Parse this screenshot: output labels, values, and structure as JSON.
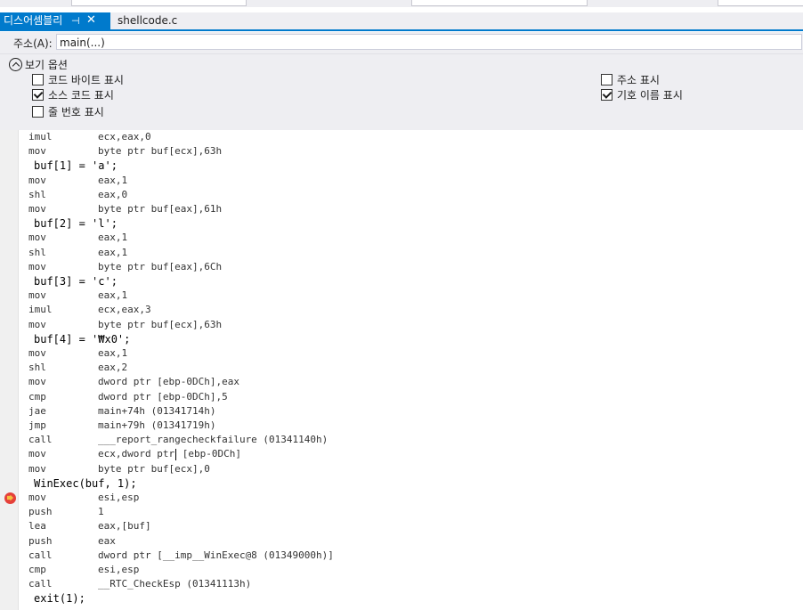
{
  "tabs": [
    {
      "label": "디스어셈블리",
      "pin": "⊣",
      "close": "✕",
      "active": true
    },
    {
      "label": "shellcode.c",
      "active": false
    }
  ],
  "address": {
    "label": "주소(A):",
    "value": "main(...)"
  },
  "options": {
    "toggle_label": "보기 옵션",
    "checkboxes": [
      {
        "label": "코드 바이트 표시",
        "checked": false
      },
      {
        "label": "소스 코드 표시",
        "checked": true
      },
      {
        "label": "줄 번호 표시",
        "checked": false
      },
      {
        "label": "주소 표시",
        "checked": false
      },
      {
        "label": "기호 이름 표시",
        "checked": true
      }
    ]
  },
  "code": [
    {
      "t": "asm",
      "m": "imul",
      "o": "ecx,eax,0"
    },
    {
      "t": "asm",
      "m": "mov",
      "o": "byte ptr buf[ecx],63h"
    },
    {
      "t": "src",
      "s": "buf[1] = 'a';"
    },
    {
      "t": "asm",
      "m": "mov",
      "o": "eax,1"
    },
    {
      "t": "asm",
      "m": "shl",
      "o": "eax,0"
    },
    {
      "t": "asm",
      "m": "mov",
      "o": "byte ptr buf[eax],61h"
    },
    {
      "t": "src",
      "s": "buf[2] = 'l';"
    },
    {
      "t": "asm",
      "m": "mov",
      "o": "eax,1"
    },
    {
      "t": "asm",
      "m": "shl",
      "o": "eax,1"
    },
    {
      "t": "asm",
      "m": "mov",
      "o": "byte ptr buf[eax],6Ch"
    },
    {
      "t": "src",
      "s": "buf[3] = 'c';"
    },
    {
      "t": "asm",
      "m": "mov",
      "o": "eax,1"
    },
    {
      "t": "asm",
      "m": "imul",
      "o": "ecx,eax,3"
    },
    {
      "t": "asm",
      "m": "mov",
      "o": "byte ptr buf[ecx],63h"
    },
    {
      "t": "src",
      "s": "buf[4] = '₩x0';"
    },
    {
      "t": "asm",
      "m": "mov",
      "o": "eax,1"
    },
    {
      "t": "asm",
      "m": "shl",
      "o": "eax,2"
    },
    {
      "t": "asm",
      "m": "mov",
      "o": "dword ptr [ebp-0DCh],eax"
    },
    {
      "t": "asm",
      "m": "cmp",
      "o": "dword ptr [ebp-0DCh],5"
    },
    {
      "t": "asm",
      "m": "jae",
      "o": "main+74h (01341714h)"
    },
    {
      "t": "asm",
      "m": "jmp",
      "o": "main+79h (01341719h)"
    },
    {
      "t": "asm",
      "m": "call",
      "o": "___report_rangecheckfailure (01341140h)"
    },
    {
      "t": "asm",
      "m": "mov",
      "o": "ecx,dword ptr [ebp-0DCh]",
      "caret": true
    },
    {
      "t": "asm",
      "m": "mov",
      "o": "byte ptr buf[ecx],0"
    },
    {
      "t": "src",
      "s": "WinExec(buf, 1);"
    },
    {
      "t": "asm",
      "m": "mov",
      "o": "esi,esp",
      "bp": true
    },
    {
      "t": "asm",
      "m": "push",
      "o": "1"
    },
    {
      "t": "asm",
      "m": "lea",
      "o": "eax,[buf]"
    },
    {
      "t": "asm",
      "m": "push",
      "o": "eax"
    },
    {
      "t": "asm",
      "m": "call",
      "o": "dword ptr [__imp__WinExec@8 (01349000h)]"
    },
    {
      "t": "asm",
      "m": "cmp",
      "o": "esi,esp"
    },
    {
      "t": "asm",
      "m": "call",
      "o": "__RTC_CheckEsp (01341113h)"
    },
    {
      "t": "src",
      "s": "exit(1);"
    }
  ]
}
